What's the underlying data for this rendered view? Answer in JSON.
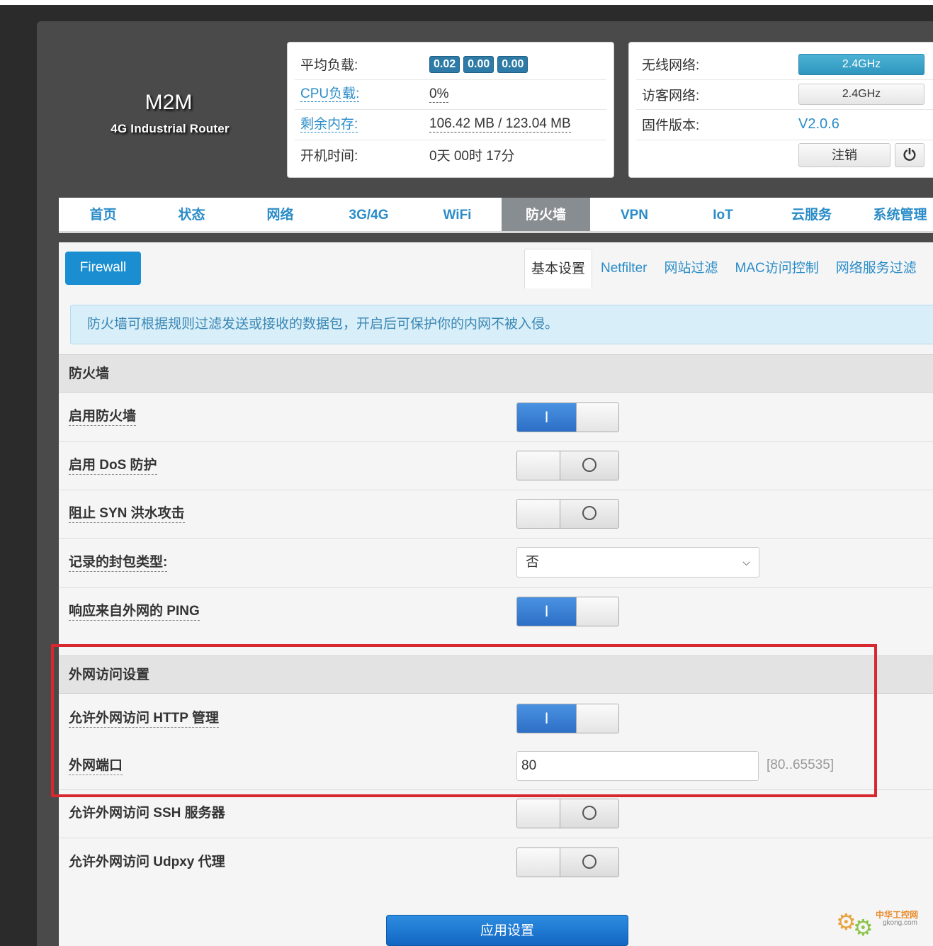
{
  "brand": {
    "name": "M2M",
    "subtitle": "4G Industrial Router"
  },
  "status": {
    "load_label": "平均负载:",
    "load_values": [
      "0.02",
      "0.00",
      "0.00"
    ],
    "cpu_label": "CPU负载:",
    "cpu_value": "0%",
    "mem_label": "剩余内存:",
    "mem_value": "106.42 MB / 123.04 MB",
    "uptime_label": "开机时间:",
    "uptime_value": "0天 00时 17分"
  },
  "wireless": {
    "wifi_label": "无线网络:",
    "wifi_button": "2.4GHz",
    "guest_label": "访客网络:",
    "guest_button": "2.4GHz",
    "firmware_label": "固件版本:",
    "firmware_value": "V2.0.6",
    "logout": "注销",
    "power_glyph": "⏻"
  },
  "nav": {
    "items": [
      "首页",
      "状态",
      "网络",
      "3G/4G",
      "WiFi",
      "防火墙",
      "VPN",
      "IoT",
      "云服务",
      "系统管理"
    ],
    "active_index": 5
  },
  "page": {
    "section_button": "Firewall",
    "tabs": [
      "基本设置",
      "Netfilter",
      "网站过滤",
      "MAC访问控制",
      "网络服务过滤"
    ],
    "active_tab": 0,
    "alert": "防火墙可根据规则过滤发送或接收的数据包，开启后可保护你的内网不被入侵。"
  },
  "firewall": {
    "section_title": "防火墙",
    "enable_fw": {
      "label": "启用防火墙",
      "on": true
    },
    "enable_dos": {
      "label": "启用 DoS 防护",
      "on": false
    },
    "block_syn": {
      "label": "阻止 SYN 洪水攻击",
      "on": false
    },
    "log_type": {
      "label": "记录的封包类型:",
      "value": "否"
    },
    "ping_wan": {
      "label": "响应来自外网的 PING",
      "on": true
    }
  },
  "wan_access": {
    "section_title": "外网访问设置",
    "http": {
      "label": "允许外网访问 HTTP 管理",
      "on": true
    },
    "port": {
      "label": "外网端口",
      "value": "80",
      "range": "[80..65535]"
    },
    "ssh": {
      "label": "允许外网访问 SSH 服务器",
      "on": false
    },
    "udpxy": {
      "label": "允许外网访问 Udpxy 代理",
      "on": false
    }
  },
  "apply_button": "应用设置",
  "toggle_on_glyph": "I",
  "watermark": {
    "line1": "中华工控网",
    "line2": "gkong.com"
  },
  "colors": {
    "accent": "#2a8cc8",
    "active_nav": "#888d91",
    "highlight_box": "#d7282f",
    "toggle_on": "#2d6fc6"
  }
}
